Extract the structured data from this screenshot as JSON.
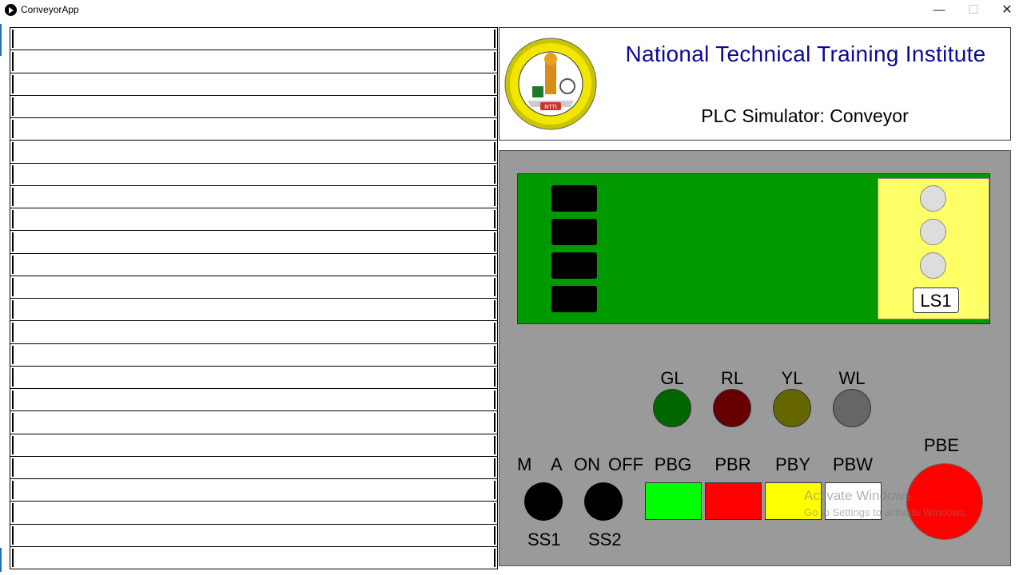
{
  "window": {
    "title": "ConveyorApp",
    "minimize": "—",
    "maximize": "☐",
    "close": "✕"
  },
  "header": {
    "institute": "National Technical Training Institute",
    "subtitle": "PLC Simulator: Conveyor",
    "logo_text": "NTTI"
  },
  "ladder": {
    "rung_count": 24
  },
  "limit_switch": {
    "label": "LS1"
  },
  "lamps": [
    {
      "label": "GL",
      "color": "#006600"
    },
    {
      "label": "RL",
      "color": "#660000"
    },
    {
      "label": "YL",
      "color": "#666600"
    },
    {
      "label": "WL",
      "color": "#666666"
    }
  ],
  "selectors": {
    "ss1": {
      "left_label": "M",
      "right_label": "A",
      "name": "SS1"
    },
    "ss2": {
      "left_label": "ON",
      "right_label": "OFF",
      "name": "SS2"
    }
  },
  "push_buttons": [
    {
      "label": "PBG",
      "color": "#00ff00"
    },
    {
      "label": "PBR",
      "color": "#ff0000"
    },
    {
      "label": "PBY",
      "color": "#ffff00"
    },
    {
      "label": "PBW",
      "color": "#ffffff"
    }
  ],
  "emergency": {
    "label": "PBE",
    "color": "#ff0000"
  },
  "watermark": {
    "line1": "Activate Windows",
    "line2": "Go to Settings to activate Windows."
  }
}
